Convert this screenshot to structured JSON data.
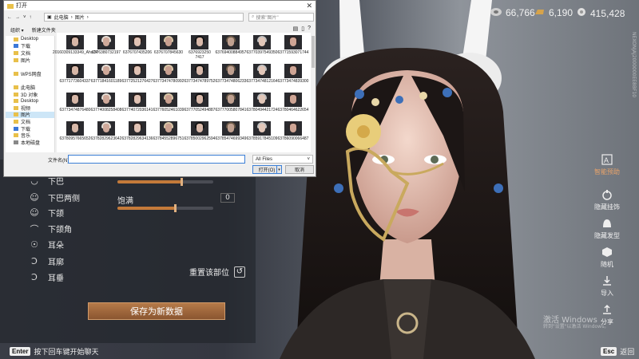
{
  "currency": [
    {
      "icon": "pearl-icon",
      "value": "66,766"
    },
    {
      "icon": "gold-bar-icon",
      "value": "6,190"
    },
    {
      "icon": "silver-coin-icon",
      "value": "415,428"
    }
  ],
  "editor": {
    "rows": [
      {
        "label": "下巴",
        "icon": "chin-icon"
      },
      {
        "label": "下巴两侧",
        "icon": "chin-sides-icon"
      },
      {
        "label": "下颌",
        "icon": "jaw-icon"
      },
      {
        "label": "下颌角",
        "icon": "jaw-angle-icon"
      },
      {
        "label": "耳朵",
        "icon": "ear-icon"
      },
      {
        "label": "耳廓",
        "icon": "auricle-icon"
      },
      {
        "label": "耳垂",
        "icon": "earlobe-icon"
      }
    ],
    "slider1_value": 0.67,
    "slider2_label": "饱满",
    "slider2_number": "0",
    "slider2_value": 0.6,
    "reset_label": "重置该部位",
    "save_new_label": "保存为新数据"
  },
  "hints": {
    "enter_key": "Enter",
    "enter_text": "按下回车键开始聊天",
    "esc_key": "Esc",
    "esc_text": "返回"
  },
  "right_toolbar": [
    {
      "label": "智能预助",
      "icon": "ai-assist-icon"
    },
    {
      "label": "隐藏挂饰",
      "icon": "hide-accessory-icon"
    },
    {
      "label": "隐藏发型",
      "icon": "hide-hairstyle-icon"
    },
    {
      "label": "随机",
      "icon": "dice-icon"
    },
    {
      "label": "导入",
      "icon": "import-icon"
    },
    {
      "label": "分享",
      "icon": "share-icon"
    }
  ],
  "watermark": {
    "line1": "激活 Windows",
    "line2": "转到\"设置\"以激活 Windows。"
  },
  "vertical_text": "NEXONJAJ2000000EE8BF10",
  "dialog": {
    "title": "打开",
    "path": [
      "此电脑",
      "图片"
    ],
    "search_placeholder": "搜索\"图片\"",
    "organize": "组织 ▾",
    "new_folder": "新建文件夹",
    "nav_items": [
      {
        "label": "Desktop",
        "icon": "desktop-folder-icon",
        "selected": false
      },
      {
        "label": "下载",
        "icon": "download-folder-icon",
        "selected": false
      },
      {
        "label": "文档",
        "icon": "documents-folder-icon",
        "selected": false
      },
      {
        "label": "图片",
        "icon": "pictures-folder-icon",
        "selected": false
      },
      {
        "label": "",
        "icon": "",
        "selected": false
      },
      {
        "label": "WPS网盘",
        "icon": "cloud-drive-icon",
        "selected": false
      },
      {
        "label": "",
        "icon": "",
        "selected": false
      },
      {
        "label": "此电脑",
        "icon": "this-pc-icon",
        "selected": false
      },
      {
        "label": "3D 对象",
        "icon": "3d-objects-icon",
        "selected": false
      },
      {
        "label": "Desktop",
        "icon": "desktop-folder-icon",
        "selected": false
      },
      {
        "label": "视频",
        "icon": "videos-folder-icon",
        "selected": false
      },
      {
        "label": "图片",
        "icon": "pictures-folder-icon",
        "selected": true
      },
      {
        "label": "文档",
        "icon": "documents-folder-icon",
        "selected": false
      },
      {
        "label": "下载",
        "icon": "download-folder-icon",
        "selected": false
      },
      {
        "label": "音乐",
        "icon": "music-folder-icon",
        "selected": false
      },
      {
        "label": "本地磁盘",
        "icon": "local-disk-icon",
        "selected": false
      }
    ],
    "files": [
      "20160309133349_AhsZ4",
      "6376380732197",
      "6376707435206",
      "6376707845630",
      "6376923250 7417",
      "63769400884957",
      "63770397549350",
      "63771593071744",
      "63771773604337",
      "63771841601189",
      "63772521276427",
      "63773474780992",
      "63773474789752",
      "63773474806233",
      "63773474812164",
      "63773474839300",
      "63773474876480",
      "63774008258408",
      "63774072036141",
      "63776052461039",
      "63777052494887",
      "63777005807841",
      "63780494421724",
      "63780464622654",
      "63780957665652",
      "63782829623642",
      "63782829634136",
      "63784552896751",
      "63785002962594",
      "63785474699349",
      "63785917845109",
      "63786090066487"
    ],
    "filename_label": "文件名(N):",
    "filename_value": "",
    "filetype": "All Files",
    "open_label": "打开(O)",
    "cancel_label": "取消"
  }
}
